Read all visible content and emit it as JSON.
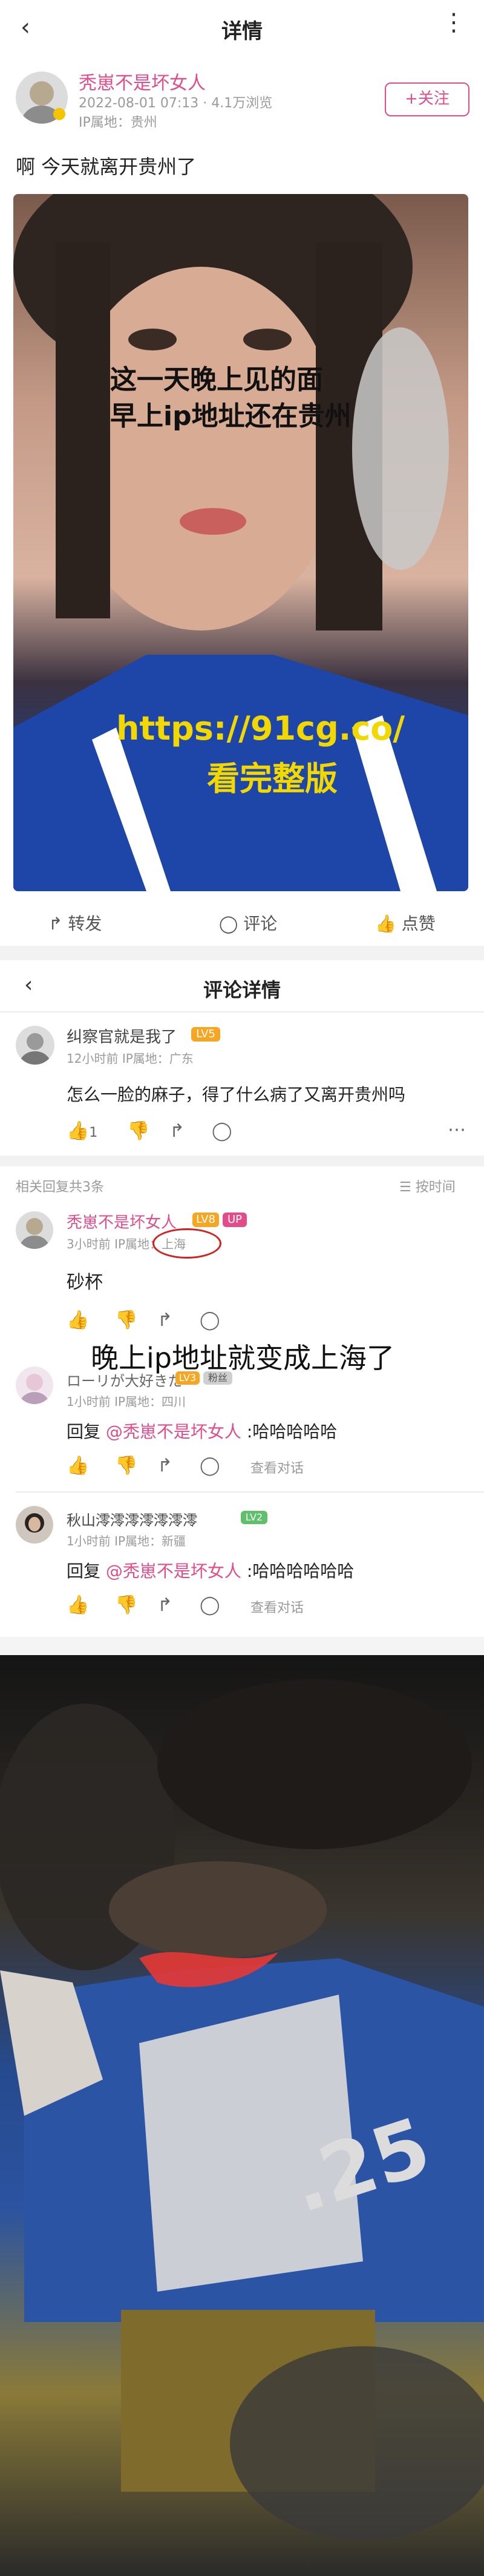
{
  "header": {
    "back_icon": "back-arrow-icon",
    "title": "详情",
    "more_icon": "more-vertical-icon"
  },
  "post": {
    "author": "秃崽不是坏女人",
    "date": "2022-08-01 07:13",
    "views": "4.1万浏览",
    "ip": "IP属地：贵州",
    "follow": "+关注",
    "text": "啊 今天就离开贵州了",
    "image_caption_line1": "这一天晚上见的面",
    "image_caption_line2": "早上ip地址还在贵州",
    "watermark_line1": "https://91cg.co/",
    "watermark_line2": "看完整版"
  },
  "actions": {
    "share": "转发",
    "comment": "评论",
    "like": "点赞"
  },
  "comment_header": {
    "title": "评论详情"
  },
  "main_comment": {
    "author": "纠察官就是我了",
    "level": "LV5",
    "time": "12小时前",
    "ip": "IP属地：广东",
    "text": "怎么一脸的麻子，得了什么病了又离开贵州吗",
    "likes": "1"
  },
  "replies_header": {
    "count": "相关回复共3条",
    "sort": "按时间"
  },
  "replies": [
    {
      "author": "秃崽不是坏女人",
      "level": "LV8",
      "badge": "UP",
      "time": "3小时前",
      "ip": "IP属地：上海",
      "text": "砂杯"
    },
    {
      "author": "ローリが大好きだ",
      "level": "LV3",
      "badge": "粉丝",
      "time": "1小时前",
      "ip": "IP属地：四川",
      "prefix": "回复",
      "mention": "@秃崽不是坏女人",
      "text": ":哈哈哈哈哈",
      "view": "查看对话"
    },
    {
      "author": "秋山澪澪澪澪澪澪澪",
      "level": "LV2",
      "time": "1小时前",
      "ip": "IP属地：新疆",
      "prefix": "回复",
      "mention": "@秃崽不是坏女人",
      "text": ":哈哈哈哈哈哈",
      "view": "查看对话"
    }
  ],
  "overlay_caption": "晚上ip地址就变成上海了",
  "colors": {
    "accent": "#e24c8a",
    "watermark": "#f3d800",
    "level_badge": "#f5a623"
  }
}
